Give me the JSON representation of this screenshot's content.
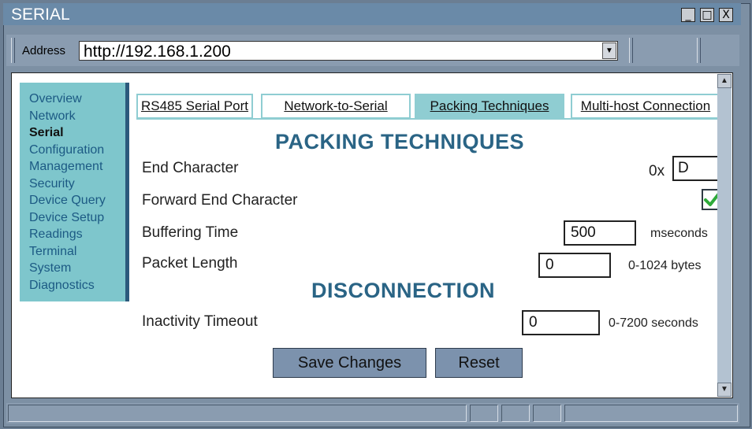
{
  "window": {
    "title": "SERIAL",
    "minimize": "_",
    "maximize": "□",
    "close": "X"
  },
  "address": {
    "label": "Address",
    "url": "http://192.168.1.200",
    "dropdown": "▼"
  },
  "sidebar": {
    "items": [
      {
        "label": "Overview"
      },
      {
        "label": "Network"
      },
      {
        "label": "Serial"
      },
      {
        "label": "Configuration"
      },
      {
        "label": "Management"
      },
      {
        "label": "Security"
      },
      {
        "label": "Device Query"
      },
      {
        "label": "Device Setup"
      },
      {
        "label": "Readings"
      },
      {
        "label": "Terminal"
      },
      {
        "label": "System"
      },
      {
        "label": "Diagnostics"
      }
    ],
    "active": "Serial"
  },
  "tabs": [
    {
      "label": "RS485 Serial Port"
    },
    {
      "label": "Network-to-Serial"
    },
    {
      "label": "Packing Techniques"
    },
    {
      "label": "Multi-host Connection"
    }
  ],
  "active_tab": "Packing Techniques",
  "packing": {
    "heading": "PACKING TECHNIQUES",
    "end_character_label": "End Character",
    "end_character_prefix": "0x",
    "end_character_value": "D",
    "forward_end_label": "Forward End Character",
    "forward_end_checked": true,
    "buffering_label": "Buffering Time",
    "buffering_value": "500",
    "buffering_unit": "mseconds",
    "packet_label": "Packet Length",
    "packet_value": "0",
    "packet_unit": "0-1024 bytes"
  },
  "disconnection": {
    "heading": "DISCONNECTION",
    "inactivity_label": "Inactivity Timeout",
    "inactivity_value": "0",
    "inactivity_unit": "0-7200 seconds"
  },
  "actions": {
    "save": "Save Changes",
    "reset": "Reset"
  },
  "colors": {
    "accent": "#2a6485",
    "tab_active": "#8fcdd2",
    "sidebar": "#7ec6cc",
    "check": "#2eaa3a"
  }
}
